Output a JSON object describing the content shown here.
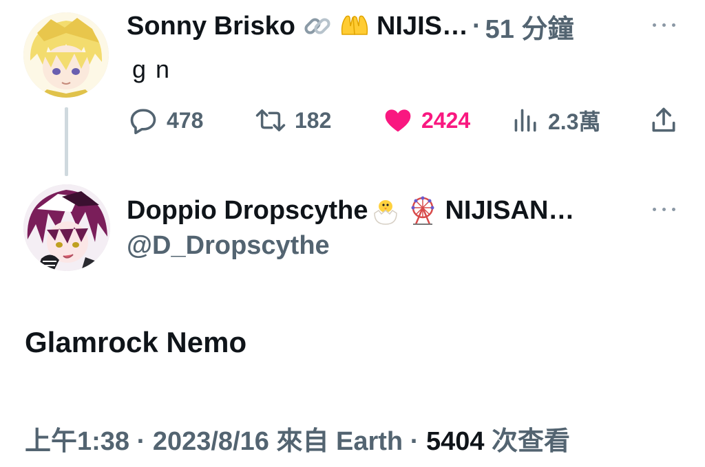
{
  "reply_tweet": {
    "display_name": "Sonny Brisko",
    "name_suffix": "NIJIS…",
    "emojis": [
      "link-emoji",
      "raised-hands-emoji"
    ],
    "separator": "·",
    "time_ago": "51 分鐘",
    "text": "g n",
    "actions": {
      "replies": "478",
      "retweets": "182",
      "likes": "2424",
      "views": "2.3萬"
    },
    "liked": true,
    "like_color": "#f91880"
  },
  "main_tweet": {
    "display_name": "Doppio Dropscythe",
    "name_suffix": "NIJISAN…",
    "emojis": [
      "hatching-chick-emoji",
      "ferris-wheel-emoji"
    ],
    "handle": "@D_Dropscythe",
    "text": "Glamrock Nemo",
    "meta": {
      "time": "上午1:38",
      "sep1": "·",
      "date_source": "2023/8/16 來自 Earth",
      "sep2": "·",
      "view_count": "5404",
      "views_label": "次查看"
    }
  },
  "colors": {
    "secondary_text": "#536471",
    "primary_text": "#0f1419",
    "thread_line": "#cfd9de",
    "like": "#f91880"
  }
}
